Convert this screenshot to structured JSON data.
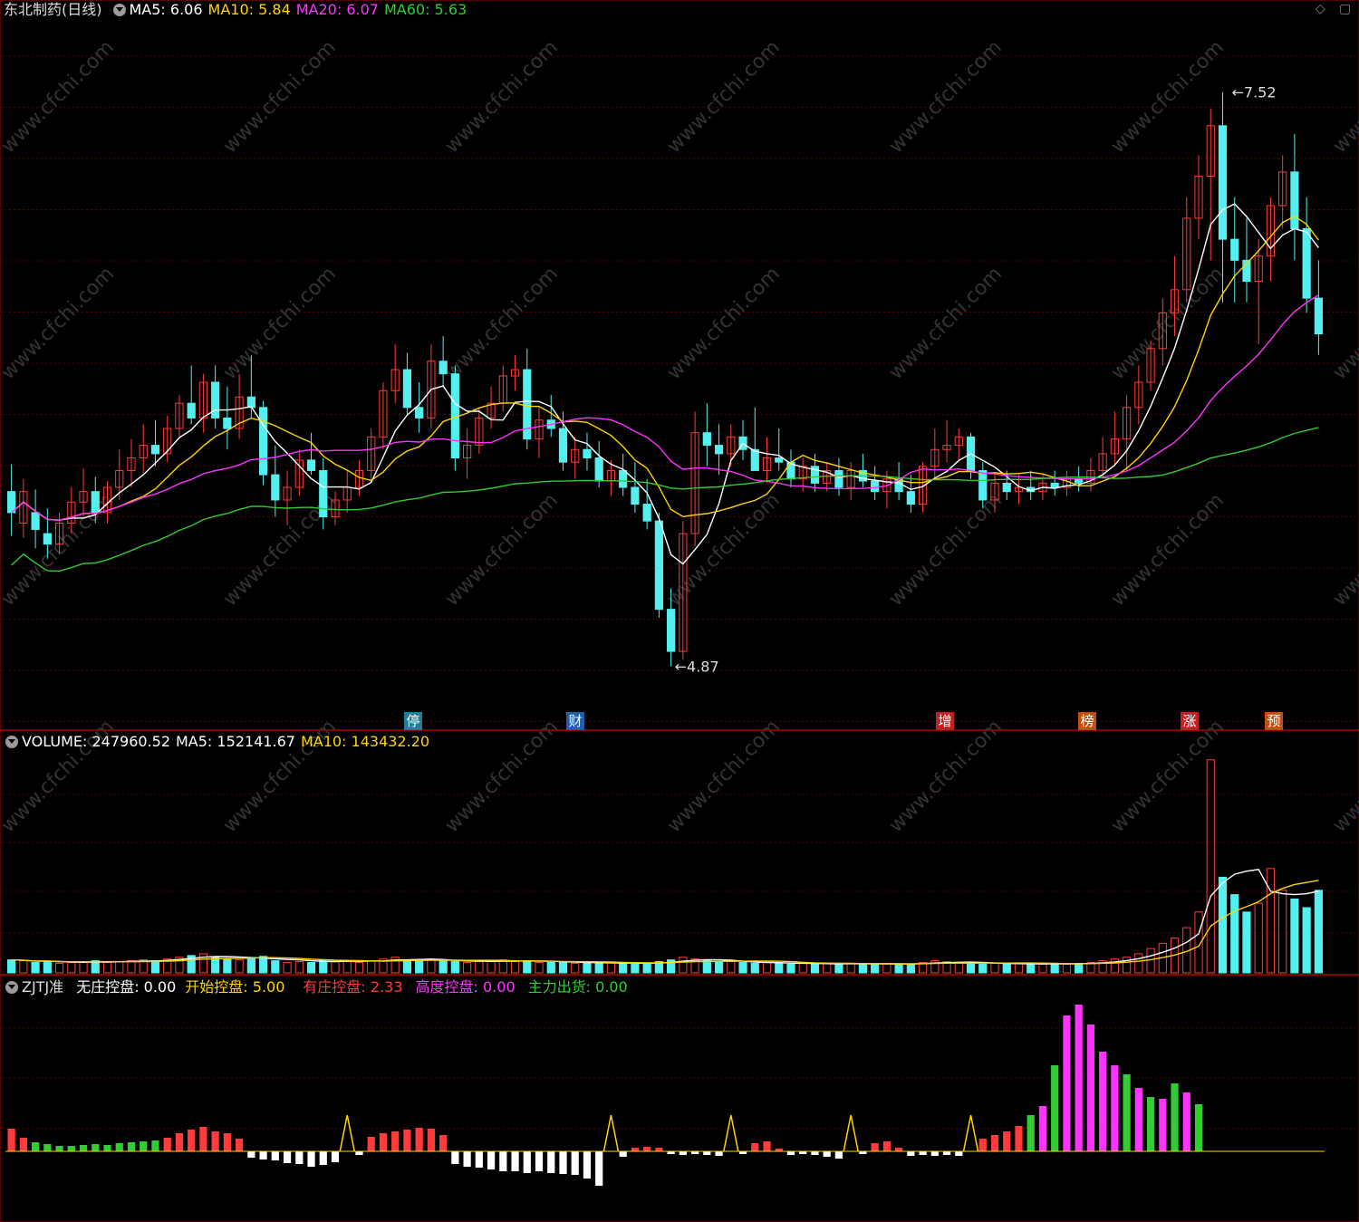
{
  "header": {
    "title": "东北制药(日线)",
    "ma5": "MA5: 6.06",
    "ma10": "MA10: 5.84",
    "ma20": "MA20: 6.07",
    "ma60": "MA60: 5.63"
  },
  "volume_header": {
    "label": "VOLUME: 247960.52",
    "ma5": "MA5: 152141.67",
    "ma10": "MA10: 143432.20"
  },
  "indicator_header": {
    "name": "ZJTJ准",
    "none": "无庄控盘: 0.00",
    "start": "开始控盘: 5.00",
    "have": "有庄控盘: 2.33",
    "high": "高度控盘: 0.00",
    "out": "主力出货: 0.00"
  },
  "annotations": {
    "high": "7.52",
    "low": "4.87"
  },
  "markers": [
    {
      "label": "停",
      "color": "#1f7f96"
    },
    {
      "label": "财",
      "color": "#1f5fa8"
    },
    {
      "label": "增",
      "color": "#c02020"
    },
    {
      "label": "榜",
      "color": "#c05010"
    },
    {
      "label": "涨",
      "color": "#c02020"
    },
    {
      "label": "预",
      "color": "#c05010"
    }
  ],
  "watermark": "www.cfchi.com",
  "colors": {
    "up": "#ff3b3b",
    "down": "#54f0f0",
    "ma5": "#ffffff",
    "ma10": "#ffd400",
    "ma20": "#ff33ff",
    "ma60": "#33cc33",
    "grid": "#5a0000"
  },
  "chart_data": {
    "type": "candlestick",
    "price_range": [
      4.6,
      7.9
    ],
    "volume_max": 250000,
    "candles": [
      [
        5.7,
        5.83,
        5.49,
        5.6
      ],
      [
        5.55,
        5.76,
        5.48,
        5.7
      ],
      [
        5.6,
        5.71,
        5.43,
        5.52
      ],
      [
        5.5,
        5.62,
        5.38,
        5.45
      ],
      [
        5.45,
        5.6,
        5.4,
        5.55
      ],
      [
        5.55,
        5.72,
        5.5,
        5.65
      ],
      [
        5.65,
        5.81,
        5.58,
        5.7
      ],
      [
        5.7,
        5.77,
        5.55,
        5.6
      ],
      [
        5.6,
        5.75,
        5.55,
        5.72
      ],
      [
        5.72,
        5.9,
        5.66,
        5.8
      ],
      [
        5.8,
        5.95,
        5.72,
        5.86
      ],
      [
        5.86,
        6.02,
        5.79,
        5.92
      ],
      [
        5.92,
        6.04,
        5.82,
        5.88
      ],
      [
        5.88,
        6.06,
        5.84,
        6.0
      ],
      [
        6.0,
        6.16,
        5.95,
        6.12
      ],
      [
        6.12,
        6.3,
        6.02,
        6.05
      ],
      [
        6.05,
        6.26,
        5.98,
        6.22
      ],
      [
        6.22,
        6.3,
        6.0,
        6.05
      ],
      [
        6.05,
        6.2,
        5.9,
        6.0
      ],
      [
        6.0,
        6.26,
        5.95,
        6.15
      ],
      [
        6.15,
        6.35,
        6.05,
        6.1
      ],
      [
        6.1,
        6.13,
        5.73,
        5.78
      ],
      [
        5.78,
        5.92,
        5.58,
        5.66
      ],
      [
        5.66,
        5.8,
        5.54,
        5.72
      ],
      [
        5.72,
        5.9,
        5.68,
        5.85
      ],
      [
        5.85,
        5.98,
        5.78,
        5.8
      ],
      [
        5.8,
        5.86,
        5.52,
        5.58
      ],
      [
        5.58,
        5.7,
        5.54,
        5.66
      ],
      [
        5.66,
        5.8,
        5.6,
        5.72
      ],
      [
        5.72,
        5.85,
        5.68,
        5.8
      ],
      [
        5.8,
        6.0,
        5.74,
        5.96
      ],
      [
        5.96,
        6.22,
        5.9,
        6.18
      ],
      [
        6.18,
        6.4,
        6.12,
        6.28
      ],
      [
        6.28,
        6.36,
        6.06,
        6.1
      ],
      [
        6.1,
        6.22,
        5.98,
        6.05
      ],
      [
        6.05,
        6.4,
        6.0,
        6.32
      ],
      [
        6.32,
        6.44,
        6.2,
        6.26
      ],
      [
        6.26,
        6.3,
        5.8,
        5.86
      ],
      [
        5.86,
        6.0,
        5.76,
        5.92
      ],
      [
        5.92,
        6.1,
        5.88,
        6.05
      ],
      [
        6.05,
        6.2,
        6.0,
        6.12
      ],
      [
        6.12,
        6.3,
        6.08,
        6.25
      ],
      [
        6.25,
        6.35,
        6.18,
        6.28
      ],
      [
        6.28,
        6.38,
        5.9,
        5.95
      ],
      [
        5.95,
        6.1,
        5.86,
        6.04
      ],
      [
        6.04,
        6.16,
        5.96,
        6.0
      ],
      [
        6.0,
        6.08,
        5.8,
        5.84
      ],
      [
        5.84,
        5.96,
        5.76,
        5.9
      ],
      [
        5.9,
        5.98,
        5.8,
        5.86
      ],
      [
        5.86,
        5.94,
        5.72,
        5.75
      ],
      [
        5.75,
        5.85,
        5.68,
        5.8
      ],
      [
        5.8,
        5.88,
        5.68,
        5.72
      ],
      [
        5.72,
        5.84,
        5.6,
        5.64
      ],
      [
        5.64,
        5.76,
        5.52,
        5.56
      ],
      [
        5.56,
        5.6,
        5.1,
        5.14
      ],
      [
        5.14,
        5.24,
        4.87,
        4.94
      ],
      [
        4.94,
        5.56,
        4.9,
        5.5
      ],
      [
        5.5,
        6.08,
        5.44,
        5.98
      ],
      [
        5.98,
        6.12,
        5.82,
        5.92
      ],
      [
        5.92,
        6.02,
        5.78,
        5.88
      ],
      [
        5.88,
        6.02,
        5.82,
        5.96
      ],
      [
        5.96,
        6.04,
        5.85,
        5.9
      ],
      [
        5.9,
        6.1,
        5.84,
        5.8
      ],
      [
        5.8,
        5.96,
        5.74,
        5.86
      ],
      [
        5.86,
        6.0,
        5.8,
        5.84
      ],
      [
        5.84,
        5.9,
        5.72,
        5.76
      ],
      [
        5.76,
        5.86,
        5.7,
        5.82
      ],
      [
        5.82,
        5.88,
        5.7,
        5.74
      ],
      [
        5.74,
        5.84,
        5.7,
        5.8
      ],
      [
        5.8,
        5.86,
        5.68,
        5.72
      ],
      [
        5.72,
        5.84,
        5.66,
        5.8
      ],
      [
        5.8,
        5.88,
        5.72,
        5.75
      ],
      [
        5.75,
        5.82,
        5.66,
        5.7
      ],
      [
        5.7,
        5.8,
        5.62,
        5.76
      ],
      [
        5.76,
        5.84,
        5.66,
        5.7
      ],
      [
        5.7,
        5.78,
        5.6,
        5.64
      ],
      [
        5.64,
        5.84,
        5.6,
        5.82
      ],
      [
        5.82,
        6.0,
        5.76,
        5.9
      ],
      [
        5.9,
        6.04,
        5.84,
        5.92
      ],
      [
        5.92,
        6.0,
        5.84,
        5.96
      ],
      [
        5.96,
        5.98,
        5.76,
        5.8
      ],
      [
        5.8,
        5.84,
        5.62,
        5.66
      ],
      [
        5.66,
        5.78,
        5.6,
        5.74
      ],
      [
        5.74,
        5.8,
        5.66,
        5.7
      ],
      [
        5.7,
        5.78,
        5.64,
        5.72
      ],
      [
        5.72,
        5.8,
        5.66,
        5.7
      ],
      [
        5.7,
        5.78,
        5.66,
        5.74
      ],
      [
        5.74,
        5.8,
        5.68,
        5.72
      ],
      [
        5.72,
        5.8,
        5.68,
        5.76
      ],
      [
        5.76,
        5.82,
        5.7,
        5.74
      ],
      [
        5.74,
        5.86,
        5.7,
        5.8
      ],
      [
        5.8,
        5.96,
        5.76,
        5.88
      ],
      [
        5.88,
        6.08,
        5.82,
        5.95
      ],
      [
        5.95,
        6.16,
        5.8,
        6.1
      ],
      [
        6.1,
        6.3,
        6.02,
        6.22
      ],
      [
        6.22,
        6.42,
        6.18,
        6.38
      ],
      [
        6.38,
        6.62,
        6.3,
        6.55
      ],
      [
        6.55,
        6.82,
        6.44,
        6.66
      ],
      [
        6.66,
        7.1,
        6.6,
        7.0
      ],
      [
        7.0,
        7.3,
        6.9,
        7.2
      ],
      [
        7.2,
        7.52,
        6.8,
        7.44
      ],
      [
        7.44,
        7.6,
        6.6,
        6.9
      ],
      [
        6.9,
        7.1,
        6.6,
        6.8
      ],
      [
        6.8,
        7.0,
        6.6,
        6.7
      ],
      [
        6.7,
        6.9,
        6.4,
        6.82
      ],
      [
        6.82,
        7.1,
        6.7,
        7.06
      ],
      [
        7.06,
        7.3,
        6.95,
        7.22
      ],
      [
        7.22,
        7.4,
        6.8,
        6.95
      ],
      [
        6.95,
        7.1,
        6.55,
        6.62
      ],
      [
        6.62,
        6.8,
        6.35,
        6.45
      ]
    ],
    "volumes": [
      15,
      14,
      12,
      13,
      11,
      12,
      13,
      14,
      12,
      13,
      14,
      15,
      14,
      16,
      18,
      20,
      22,
      18,
      16,
      15,
      17,
      19,
      14,
      12,
      13,
      12,
      15,
      13,
      14,
      12,
      14,
      16,
      18,
      15,
      14,
      16,
      14,
      13,
      12,
      13,
      14,
      15,
      13,
      14,
      12,
      13,
      12,
      11,
      12,
      11,
      12,
      11,
      10,
      11,
      13,
      15,
      18,
      16,
      14,
      12,
      13,
      12,
      11,
      12,
      11,
      10,
      11,
      10,
      11,
      10,
      11,
      10,
      10,
      11,
      10,
      10,
      12,
      14,
      13,
      12,
      11,
      10,
      11,
      10,
      11,
      10,
      10,
      11,
      10,
      11,
      12,
      14,
      16,
      18,
      22,
      28,
      34,
      40,
      52,
      70,
      245,
      110,
      90,
      70,
      80,
      120,
      95,
      85,
      75,
      95
    ],
    "indicator": [
      25,
      15,
      10,
      8,
      6,
      6,
      7,
      8,
      7,
      9,
      10,
      11,
      12,
      15,
      20,
      24,
      27,
      22,
      20,
      14,
      -7,
      -9,
      -10,
      -13,
      -14,
      -17,
      -15,
      -12,
      25,
      -4,
      16,
      20,
      22,
      24,
      26,
      25,
      18,
      -14,
      -17,
      -18,
      -20,
      -22,
      -22,
      -24,
      -22,
      -24,
      -25,
      -26,
      -30,
      -38,
      25,
      -6,
      4,
      5,
      4,
      -3,
      -4,
      -3,
      -4,
      -5,
      25,
      -3,
      9,
      11,
      3,
      -4,
      -3,
      -4,
      -6,
      -8,
      25,
      -3,
      9,
      11,
      4,
      -5,
      -4,
      -5,
      -4,
      -5,
      25,
      14,
      18,
      22,
      28,
      40,
      50,
      95,
      150,
      162,
      140,
      110,
      95,
      85,
      70,
      60,
      58,
      75,
      65,
      52
    ]
  }
}
